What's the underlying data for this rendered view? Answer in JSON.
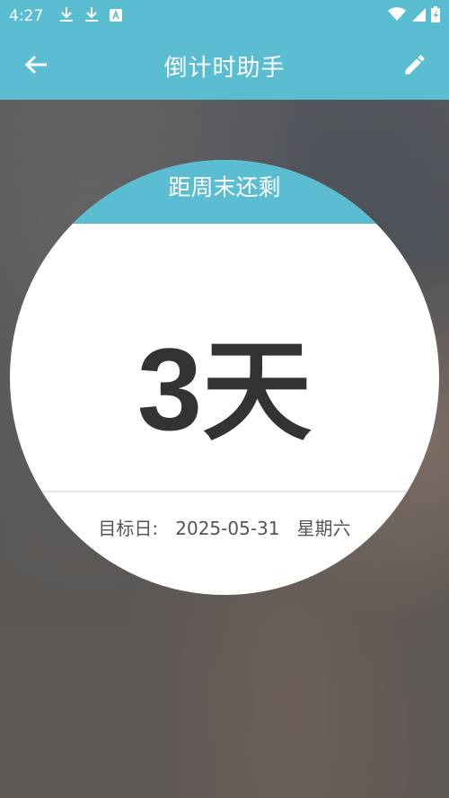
{
  "status_bar": {
    "time": "4:27",
    "left_icons": [
      "download-icon",
      "download-icon",
      "keyboard-a-icon"
    ],
    "right_icons": [
      "wifi-icon",
      "signal-icon",
      "battery-icon"
    ]
  },
  "app_bar": {
    "title": "倒计时助手",
    "back_icon": "arrow-left-icon",
    "edit_icon": "pencil-icon",
    "color": "#5bbdd2"
  },
  "countdown": {
    "header": "距周末还剩",
    "number": "3",
    "unit": "天",
    "target_label": "目标日:",
    "target_date": "2025-05-31",
    "weekday": "星期六"
  }
}
